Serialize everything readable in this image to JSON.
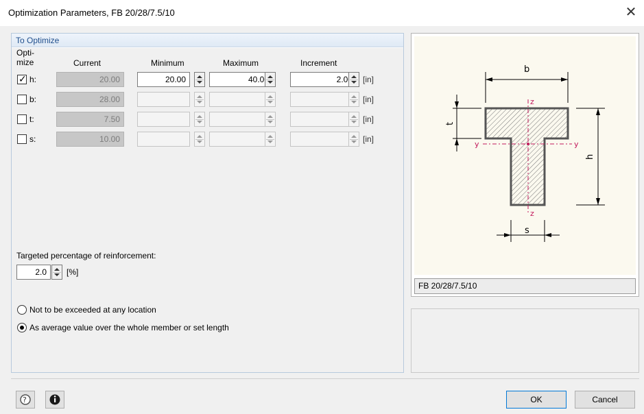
{
  "window": {
    "title": "Optimization Parameters, FB 20/28/7.5/10",
    "close_symbol": "✕"
  },
  "group": {
    "title": "To Optimize",
    "headers": {
      "optimize": "Opti-\nmize",
      "current": "Current",
      "minimum": "Minimum",
      "maximum": "Maximum",
      "increment": "Increment"
    },
    "rows": [
      {
        "label": "h:",
        "checked": true,
        "current": "20.00",
        "minimum": "20.00",
        "maximum": "40.00",
        "increment": "2.00",
        "unit": "[in]"
      },
      {
        "label": "b:",
        "checked": false,
        "current": "28.00",
        "minimum": "",
        "maximum": "",
        "increment": "",
        "unit": "[in]"
      },
      {
        "label": "t:",
        "checked": false,
        "current": "7.50",
        "minimum": "",
        "maximum": "",
        "increment": "",
        "unit": "[in]"
      },
      {
        "label": "s:",
        "checked": false,
        "current": "10.00",
        "minimum": "",
        "maximum": "",
        "increment": "",
        "unit": "[in]"
      }
    ],
    "reinforcement": {
      "label": "Targeted percentage of reinforcement:",
      "value": "2.0",
      "unit": "[%]"
    },
    "options": [
      {
        "label": "Not to be exceeded at any location",
        "selected": false
      },
      {
        "label": "As average value over the whole member or set length",
        "selected": true
      }
    ]
  },
  "diagram": {
    "labels": {
      "b": "b",
      "t": "t",
      "h": "h",
      "s": "s",
      "y_left": "y",
      "y_right": "y",
      "z_top": "z",
      "z_bottom": "z"
    },
    "description": "FB 20/28/7.5/10"
  },
  "footer": {
    "help_icon": "help-icon",
    "info_icon": "info-icon",
    "ok_label": "OK",
    "cancel_label": "Cancel"
  },
  "colors": {
    "group_title": "#1f4e8c",
    "axis": "#c2185b",
    "default_button_border": "#0078d7"
  }
}
